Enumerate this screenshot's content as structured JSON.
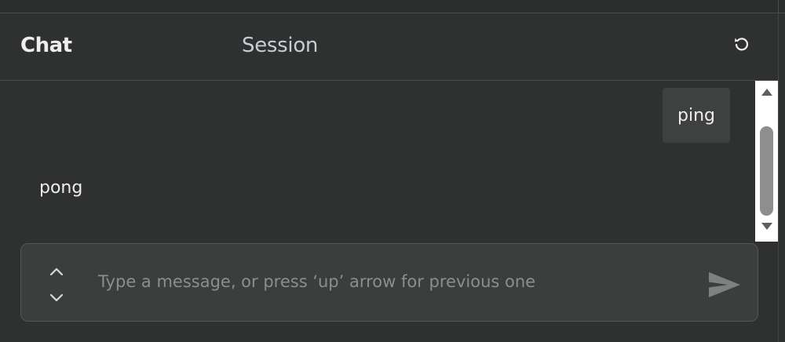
{
  "header": {
    "tabs": [
      {
        "label": "Chat",
        "active": true
      },
      {
        "label": "Session",
        "active": false
      }
    ],
    "reset_icon": "reset-icon"
  },
  "messages": [
    {
      "role": "user",
      "text": "ping"
    },
    {
      "role": "assistant",
      "text": "pong"
    }
  ],
  "scrollbar": {
    "up_icon": "scroll-up-arrow-icon",
    "down_icon": "scroll-down-arrow-icon"
  },
  "input": {
    "value": "",
    "placeholder": "Type a message, or press ‘up’ arrow for previous one",
    "history_up_icon": "chevron-up-icon",
    "history_down_icon": "chevron-down-icon",
    "send_icon": "send-icon"
  },
  "colors": {
    "background": "#2f3030",
    "user_bubble": "#3f4141",
    "input_background": "#3c3d3d",
    "placeholder": "#8b8d8f",
    "text": "#eeeeee"
  }
}
